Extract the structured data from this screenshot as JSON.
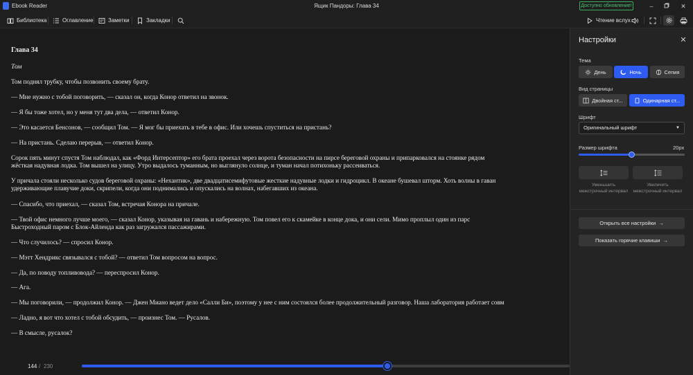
{
  "window": {
    "app_name": "Ebook Reader",
    "title": "Ящик Пандоры: Глава 34",
    "update_label": "Доступно обновление!",
    "colors": {
      "accent": "#2f5cf0",
      "update_green": "#4cc273",
      "background": "#1b1b1b",
      "panel": "#242424"
    }
  },
  "toolbar": {
    "library": "Библиотека",
    "contents": "Оглавление",
    "notes": "Заметки",
    "bookmarks": "Закладки",
    "read_aloud": "Чтение вслух"
  },
  "book": {
    "chapter": "Глава 34",
    "subtitle": "Том",
    "paragraphs": [
      [
        "Том поднял трубку, чтобы позвонить своему брату."
      ],
      [
        "— Мне нужно с тобой поговорить, — сказал он, когда Конор ответил на звонок."
      ],
      [
        "— Я бы тоже хотел, но у меня тут два дела, — ответил Конор."
      ],
      [
        "— Это касается Бенсонов, — сообщил Том. — Я мог бы приехать в тебе в офис. Или хочешь спуститься на пристань?"
      ],
      [
        "— На пристань. Сделаю перерыв, — ответил Конор."
      ],
      [
        "Сорок пять минут спустя Том наблюдал, как «Форд Интерсептор» его брата проехал через ворота безопасности на пирсе береговой охраны и припарковался на стоянке рядом",
        "жёсткая надувная лодка. Том вышел на улицу. Утро выдалось туманным, но выглянуло солнце, и туман начал потихоньку рассеиваться."
      ],
      [
        "У причала стояли несколько судов береговой охраны: «Нехантик», две двадцатисемифутовые жесткие надувные лодки и гидроцикл. В океане бушевал шторм. Хоть волны в гаван",
        "удерживающие плавучие доки, скрипели, когда они поднимались и опускались на волнах, набегавших из океана."
      ],
      [
        "— Спасибо, что приехал, — сказал Том, встречая Конора на причале."
      ],
      [
        "— Твой офис немного лучше моего, — сказал Конор, указывая на гавань и набережную. Том повел его к скамейке в конце дока, и они сели. Мимо проплыл один из парс",
        "Быстроходный паром с Блок-Айленда как раз загружался пассажирами."
      ],
      [
        "— Что случилось? — спросил Конор."
      ],
      [
        "— Мэтт Хендрикс связывался с тобой? — ответил Том вопросом на вопрос."
      ],
      [
        "— Да, по поводу топливовода? — переспросил Конор."
      ],
      [
        "— Ага."
      ],
      [
        "— Мы поговорили, — продолжил Конор. — Джен Миано ведет дело «Салли Би», поэтому у нее с ним состоялся более продолжительный разговор. Наша лаборатория работает совм"
      ],
      [
        "— Ладно, я вот что хотел с тобой обсудить, — произнес Том. — Русалов."
      ],
      [
        "— В смысле, русалок?"
      ]
    ]
  },
  "progress": {
    "current_page": "144",
    "separator": "/",
    "total_pages": "230",
    "fraction": 0.6259
  },
  "settings": {
    "title": "Настройки",
    "theme_label": "Тема",
    "themes": [
      "День",
      "Ночь",
      "Сепия"
    ],
    "active_theme": "Ночь",
    "page_view_label": "Вид страницы",
    "page_views": [
      "Двойная ст...",
      "Одинарная ст..."
    ],
    "active_page_view": "Одинарная ст...",
    "font_label": "Шрифт",
    "font_value": "Оригинальный шрифт",
    "font_size_label": "Размер шрифта",
    "font_size_value": "20px",
    "font_size_fraction": 0.5,
    "decrease_spacing": "Уменьшить межстрочный интервал",
    "increase_spacing": "Увеличить межстрочный интервал",
    "open_all_settings": "Открыть все настройки",
    "show_hotkeys": "Показать горячие клавиши"
  }
}
